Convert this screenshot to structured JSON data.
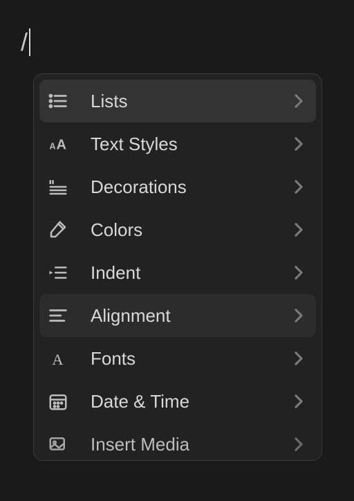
{
  "input": {
    "slash": "/"
  },
  "menu": {
    "items": [
      {
        "id": "lists",
        "label": "Lists",
        "icon": "list-icon",
        "highlighted": true
      },
      {
        "id": "text-styles",
        "label": "Text Styles",
        "icon": "text-styles-icon",
        "highlighted": false
      },
      {
        "id": "decorations",
        "label": "Decorations",
        "icon": "decorations-icon",
        "highlighted": false
      },
      {
        "id": "colors",
        "label": "Colors",
        "icon": "colors-icon",
        "highlighted": false
      },
      {
        "id": "indent",
        "label": "Indent",
        "icon": "indent-icon",
        "highlighted": false
      },
      {
        "id": "alignment",
        "label": "Alignment",
        "icon": "alignment-icon",
        "highlighted": "alt"
      },
      {
        "id": "fonts",
        "label": "Fonts",
        "icon": "fonts-icon",
        "highlighted": false
      },
      {
        "id": "date-time",
        "label": "Date & Time",
        "icon": "date-time-icon",
        "highlighted": false
      },
      {
        "id": "insert-media",
        "label": "Insert Media",
        "icon": "insert-media-icon",
        "highlighted": false
      }
    ]
  }
}
